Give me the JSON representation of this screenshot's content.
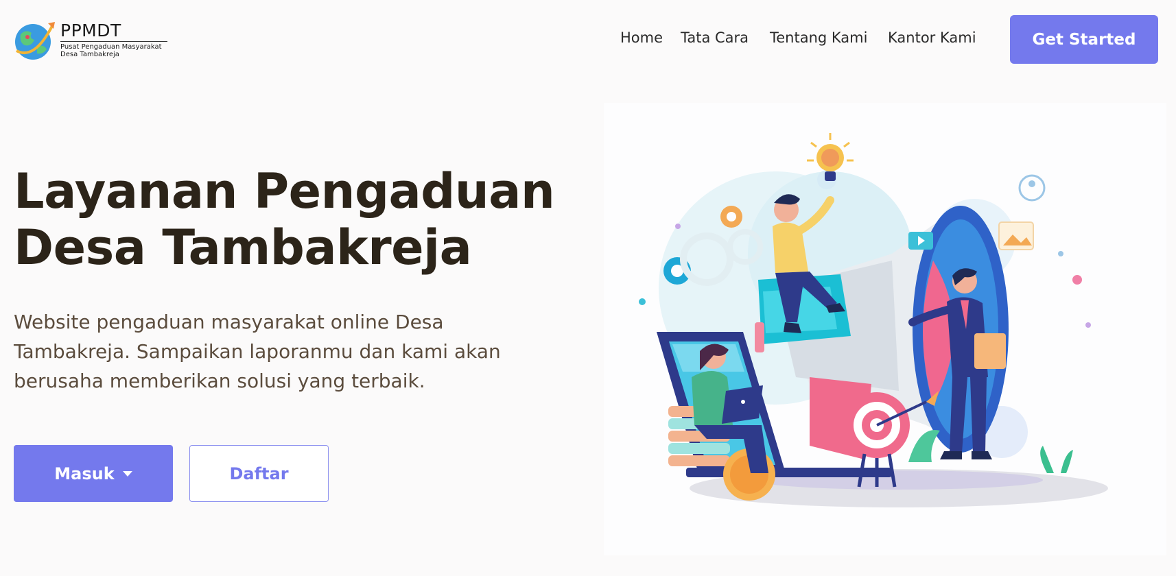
{
  "header": {
    "logo_title": "PPMDT",
    "logo_subtitle_line1": "Pusat Pengaduan Masyarakat",
    "logo_subtitle_line2": "Desa Tambakreja",
    "nav": [
      "Home",
      "Tata Cara",
      "Tentang Kami",
      "Kantor Kami"
    ],
    "cta_label": "Get Started"
  },
  "hero": {
    "title_line1": "Layanan Pengaduan",
    "title_line2": "Desa Tambakreja",
    "description": "Website pengaduan masyarakat online Desa Tambakreja. Sampaikan laporanmu dan kami akan berusaha memberikan solusi yang terbaik.",
    "login_label": "Masuk",
    "register_label": "Daftar"
  },
  "colors": {
    "accent": "#7479ed",
    "heading": "#2c2419",
    "body_text": "#5b4c3d"
  },
  "icons": {
    "logo": "globe-rocket-icon",
    "dropdown": "caret-down-icon",
    "illustration": "megaphone-complaint-illustration"
  }
}
